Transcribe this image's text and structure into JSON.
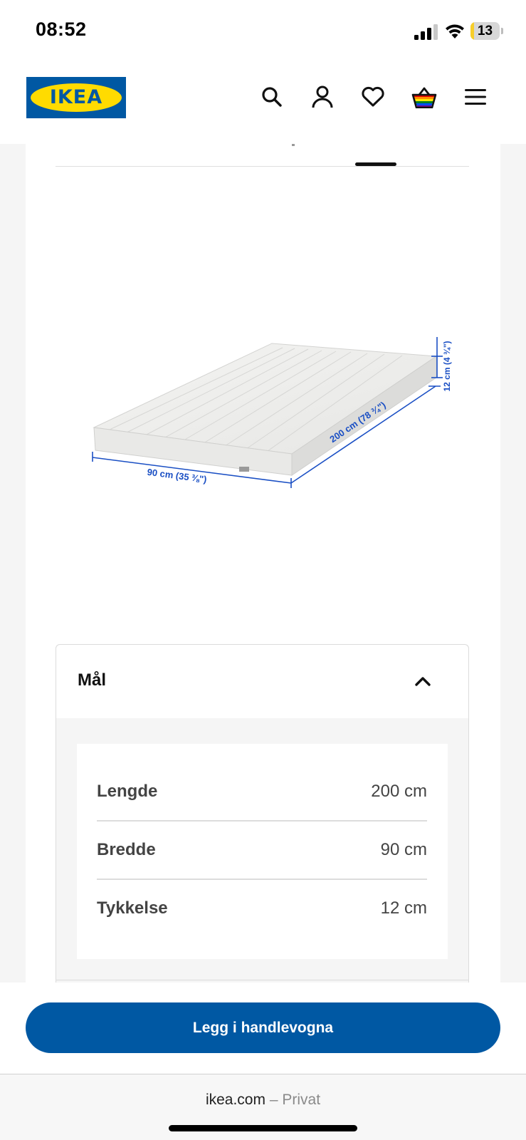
{
  "status_bar": {
    "time": "08:52",
    "battery_percent": "13",
    "battery_level": 0.13,
    "icons": [
      "signal-icon",
      "wifi-icon",
      "battery-icon"
    ]
  },
  "header": {
    "logo_text": "IKEA",
    "icons": [
      "search-icon",
      "user-icon",
      "heart-icon",
      "cart-icon",
      "menu-icon"
    ],
    "brand_colors": {
      "blue": "#0058a3",
      "yellow": "#ffdb00"
    }
  },
  "product_image": {
    "length_label": "200 cm (78 ¾\")",
    "width_label": "90 cm (35 ⅜\")",
    "thickness_label": "12 cm (4 ¾\")",
    "dimension_color": "#1a4fc4"
  },
  "dimensions": {
    "title": "Mål",
    "rows": [
      {
        "label": "Lengde",
        "value": "200 cm"
      },
      {
        "label": "Bredde",
        "value": "90 cm"
      },
      {
        "label": "Tykkelse",
        "value": "12 cm"
      }
    ]
  },
  "cta": {
    "add_to_cart_label": "Legg i handlevogna",
    "color": "#0058a3"
  },
  "browser": {
    "domain": "ikea.com",
    "separator": " – ",
    "mode": "Privat"
  }
}
